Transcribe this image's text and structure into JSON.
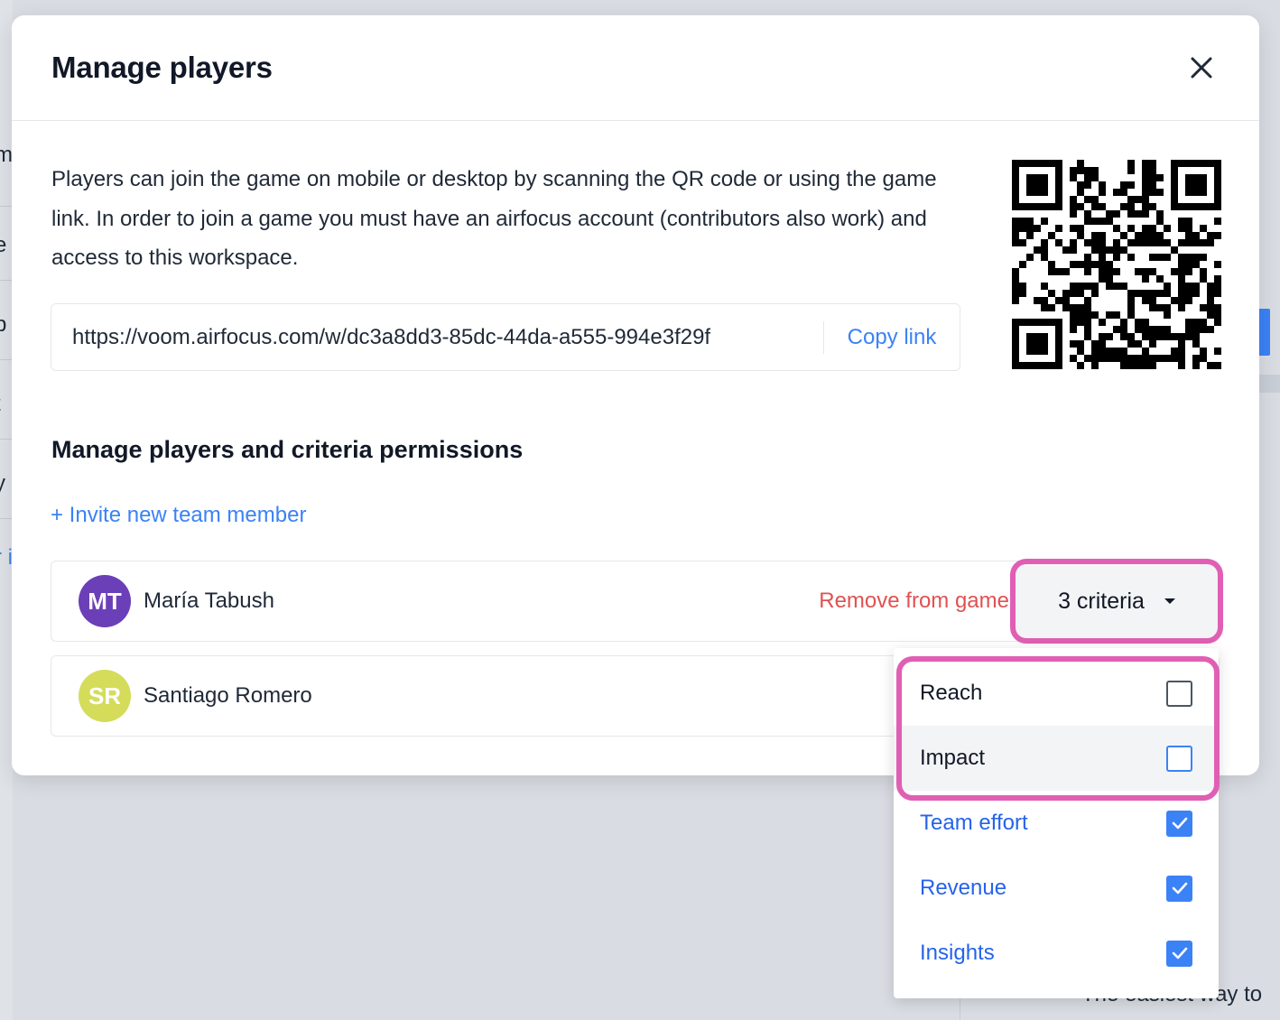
{
  "background": {
    "left_fragments": [
      "m",
      "e",
      "p",
      "t",
      "y",
      "r i"
    ],
    "bottom_text": "The easiest way to"
  },
  "modal": {
    "title": "Manage players",
    "description": "Players can join the game on mobile or desktop by scanning the QR code or using the game link. In order to join a game you must have an airfocus account (contributors also work) and access to this workspace.",
    "game_link": "https://voom.airfocus.com/w/dc3a8dd3-85dc-44da-a555-994e3f29f",
    "copy_link_label": "Copy link",
    "section_title": "Manage players and criteria permissions",
    "invite_label": "+ Invite new team member",
    "players": [
      {
        "initials": "MT",
        "name": "María Tabush",
        "avatar_color": "#6b3fb8",
        "remove_label": "Remove from game"
      },
      {
        "initials": "SR",
        "name": "Santiago Romero",
        "avatar_color": "#d4dc5a"
      }
    ],
    "criteria_button_label": "3 criteria"
  },
  "criteria_dropdown": {
    "items": [
      {
        "label": "Reach",
        "checked": false
      },
      {
        "label": "Impact",
        "checked": false
      },
      {
        "label": "Team effort",
        "checked": true
      },
      {
        "label": "Revenue",
        "checked": true
      },
      {
        "label": "Insights",
        "checked": true
      }
    ]
  },
  "colors": {
    "accent": "#3b82f6",
    "danger": "#e05252",
    "highlight": "#e05fb4"
  }
}
